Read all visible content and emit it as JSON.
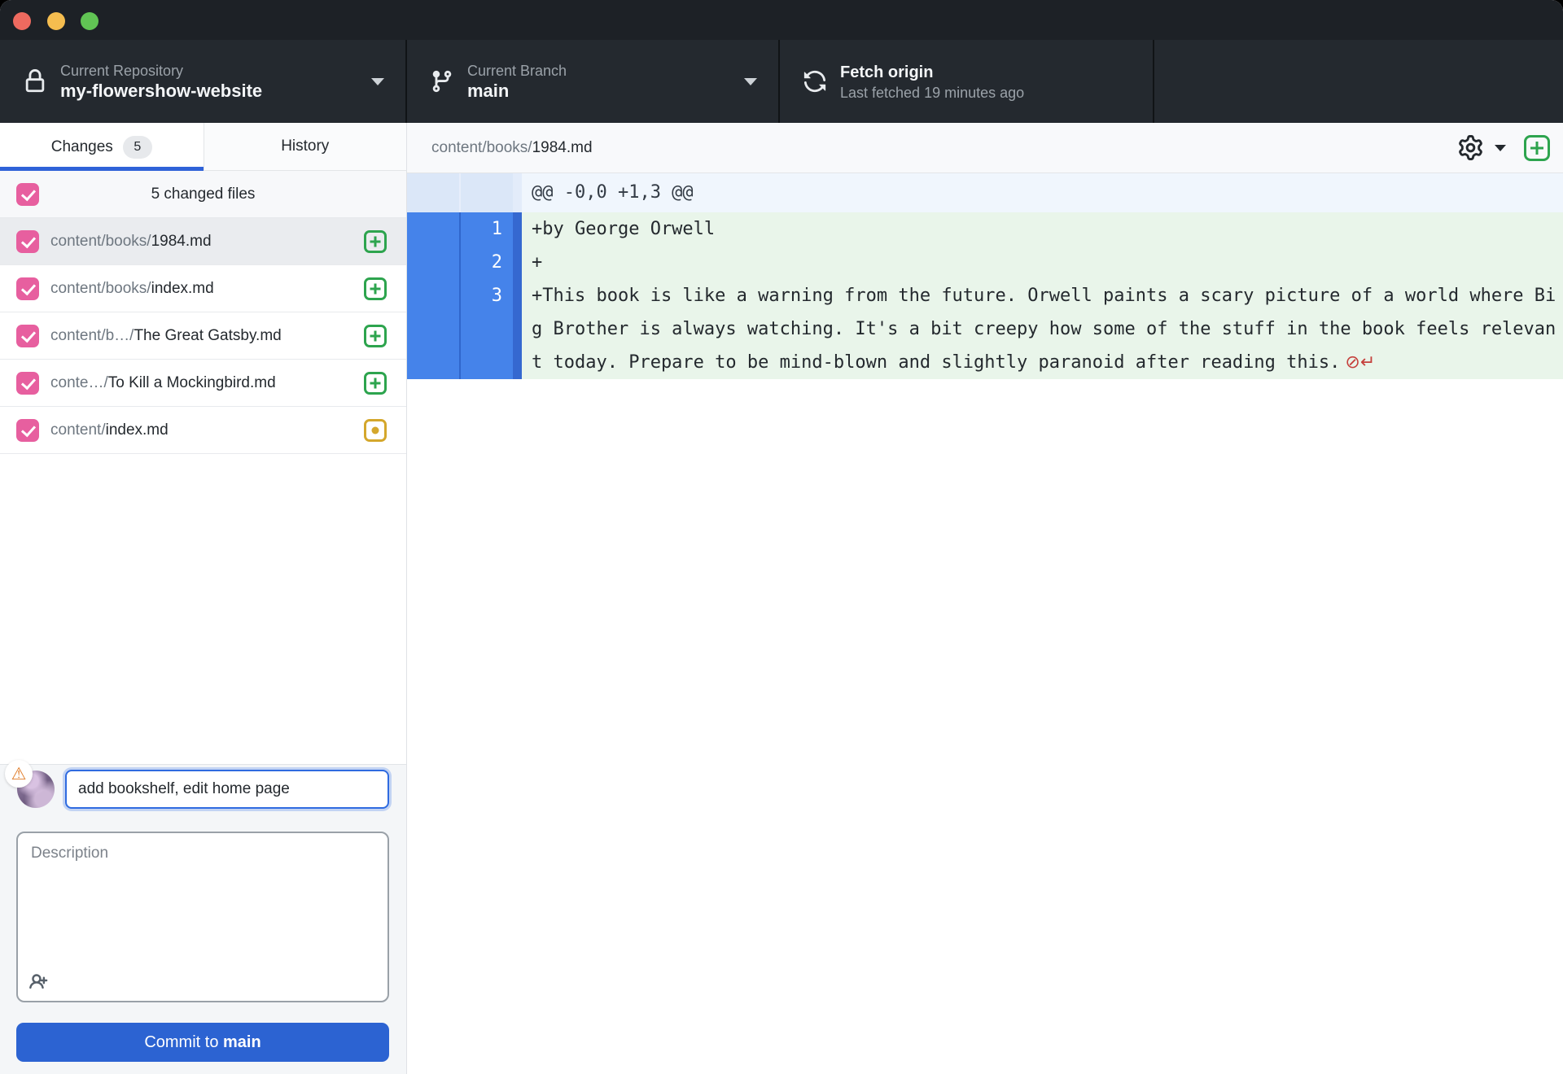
{
  "toolbar": {
    "repository": {
      "label": "Current Repository",
      "value": "my-flowershow-website"
    },
    "branch": {
      "label": "Current Branch",
      "value": "main"
    },
    "fetch": {
      "label": "Fetch origin",
      "status": "Last fetched 19 minutes ago"
    }
  },
  "sidebar": {
    "tabs": [
      {
        "label": "Changes",
        "badge": "5",
        "active": true
      },
      {
        "label": "History",
        "active": false
      }
    ],
    "files_header": "5 changed files",
    "files": [
      {
        "prefix": "content/books/",
        "name": "1984.md",
        "status": "added",
        "checked": true,
        "selected": true
      },
      {
        "prefix": "content/books/",
        "name": "index.md",
        "status": "added",
        "checked": true,
        "selected": false
      },
      {
        "prefix": "content/b…/",
        "name": "The Great Gatsby.md",
        "status": "added",
        "checked": true,
        "selected": false
      },
      {
        "prefix": "conte…/",
        "name": "To Kill a Mockingbird.md",
        "status": "added",
        "checked": true,
        "selected": false
      },
      {
        "prefix": "content/",
        "name": "index.md",
        "status": "modified",
        "checked": true,
        "selected": false
      }
    ],
    "commit": {
      "summary_value": "add bookshelf, edit home page",
      "description_placeholder": "Description",
      "button_prefix": "Commit to ",
      "button_branch": "main"
    }
  },
  "diff": {
    "file_path_prefix": "content/books/",
    "file_name": "1984.md",
    "hunk_header": "@@ -0,0 +1,3 @@",
    "no_newline_marker": "⊘↵",
    "lines": [
      {
        "new_line": "1",
        "text": "+by George Orwell",
        "no_newline": false
      },
      {
        "new_line": "2",
        "text": "+",
        "no_newline": false
      },
      {
        "new_line": "3",
        "text": "+This book is like a warning from the future. Orwell paints a scary picture of a world where Big Brother is always watching. It's a bit creepy how some of the stuff in the book feels relevant today. Prepare to be mind-blown and slightly paranoid after reading this.",
        "no_newline": true
      }
    ]
  },
  "colors": {
    "accent_blue": "#2f62d8",
    "commit_button_blue": "#2c63d2",
    "checkbox_pink": "#e75f9f",
    "added_green": "#2da44e",
    "modified_yellow": "#d4a72c",
    "diff_gutter_blue": "#4583ea",
    "diff_added_bg": "#e9f5ea",
    "no_newline_red": "#c5403c",
    "toolbar_bg": "#24292f"
  }
}
